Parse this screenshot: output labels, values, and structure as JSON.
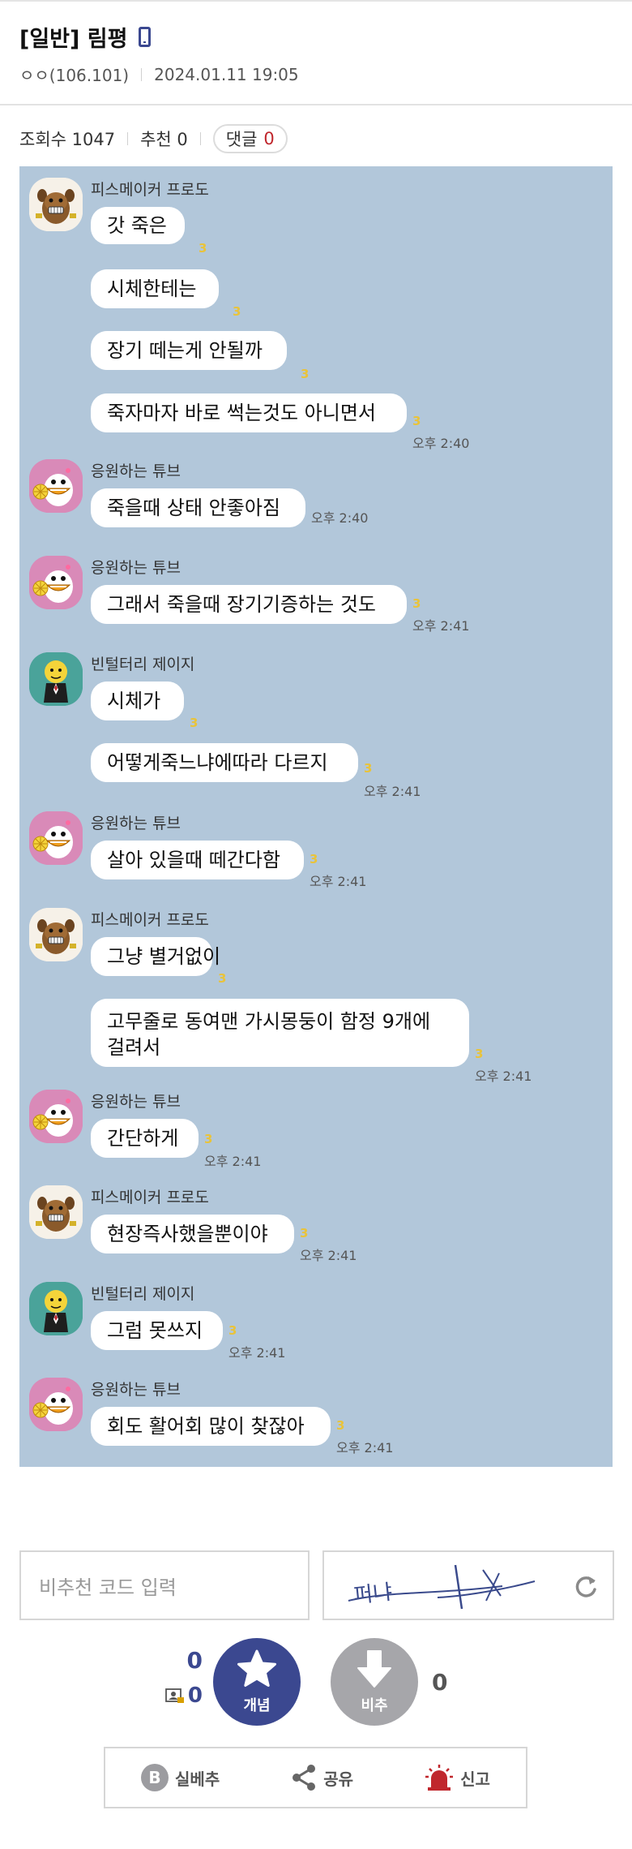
{
  "post": {
    "title": "[일반] 림평",
    "author": "ㅇㅇ(106.101)",
    "datetime": "2024.01.11 19:05"
  },
  "stats": {
    "views": "조회수 1047",
    "recommend": "추천 0",
    "comments_label": "댓글",
    "comments_count": "0"
  },
  "chat": {
    "groups": [
      {
        "sender": "피스메이커 프로도",
        "avatar": "frodo",
        "messages": [
          {
            "text": "갓 죽은",
            "unread": "3",
            "time": ""
          },
          {
            "text": "시체한테는",
            "unread": "3",
            "time": ""
          },
          {
            "text": "장기 떼는게 안될까",
            "unread": "3",
            "time": ""
          },
          {
            "text": "죽자마자 바로 썩는것도 아니면서",
            "unread": "3",
            "time": "오후 2:40"
          }
        ]
      },
      {
        "sender": "응원하는 튜브",
        "avatar": "tube",
        "messages": [
          {
            "text": "죽을때 상태 안좋아짐",
            "unread": "",
            "time": "오후 2:40"
          }
        ]
      },
      {
        "sender": "응원하는 튜브",
        "avatar": "tube",
        "messages": [
          {
            "text": "그래서 죽을때 장기기증하는 것도",
            "unread": "3",
            "time": "오후 2:41"
          }
        ]
      },
      {
        "sender": "빈털터리 제이지",
        "avatar": "jayg",
        "messages": [
          {
            "text": "시체가",
            "unread": "3",
            "time": ""
          },
          {
            "text": "어떻게죽느냐에따라 다르지",
            "unread": "3",
            "time": "오후 2:41"
          }
        ]
      },
      {
        "sender": "응원하는 튜브",
        "avatar": "tube",
        "messages": [
          {
            "text": "살아 있을때 떼간다함",
            "unread": "3",
            "time": "오후 2:41"
          }
        ]
      },
      {
        "sender": "피스메이커 프로도",
        "avatar": "frodo",
        "messages": [
          {
            "text": "그냥 별거없이",
            "unread": "3",
            "time": ""
          },
          {
            "text": "고무줄로 동여맨 가시몽둥이 함정 9개에 걸려서",
            "unread": "3",
            "time": "오후 2:41"
          }
        ]
      },
      {
        "sender": "응원하는 튜브",
        "avatar": "tube",
        "messages": [
          {
            "text": "간단하게",
            "unread": "3",
            "time": "오후 2:41"
          }
        ]
      },
      {
        "sender": "피스메이커 프로도",
        "avatar": "frodo",
        "messages": [
          {
            "text": "현장즉사했을뿐이야",
            "unread": "3",
            "time": "오후 2:41"
          }
        ]
      },
      {
        "sender": "빈털터리 제이지",
        "avatar": "jayg",
        "messages": [
          {
            "text": "그럼 못쓰지",
            "unread": "3",
            "time": "오후 2:41"
          }
        ]
      },
      {
        "sender": "응원하는 튜브",
        "avatar": "tube",
        "messages": [
          {
            "text": "회도 활어회 많이 찾잖아",
            "unread": "3",
            "time": "오후 2:41"
          }
        ]
      }
    ]
  },
  "captcha": {
    "placeholder": "비추천 코드 입력",
    "image_text": "퍼냐"
  },
  "vote": {
    "up_count": "0",
    "fixed_up_count": "0",
    "up_label": "개념",
    "down_label": "비추",
    "down_count": "0"
  },
  "actions": {
    "best_label": "실베추",
    "share_label": "공유",
    "report_label": "신고"
  },
  "colors": {
    "accent": "#3b4890",
    "chat_bg": "#b2c7da",
    "comment_count": "#c0272d",
    "report_red": "#c0272d"
  }
}
